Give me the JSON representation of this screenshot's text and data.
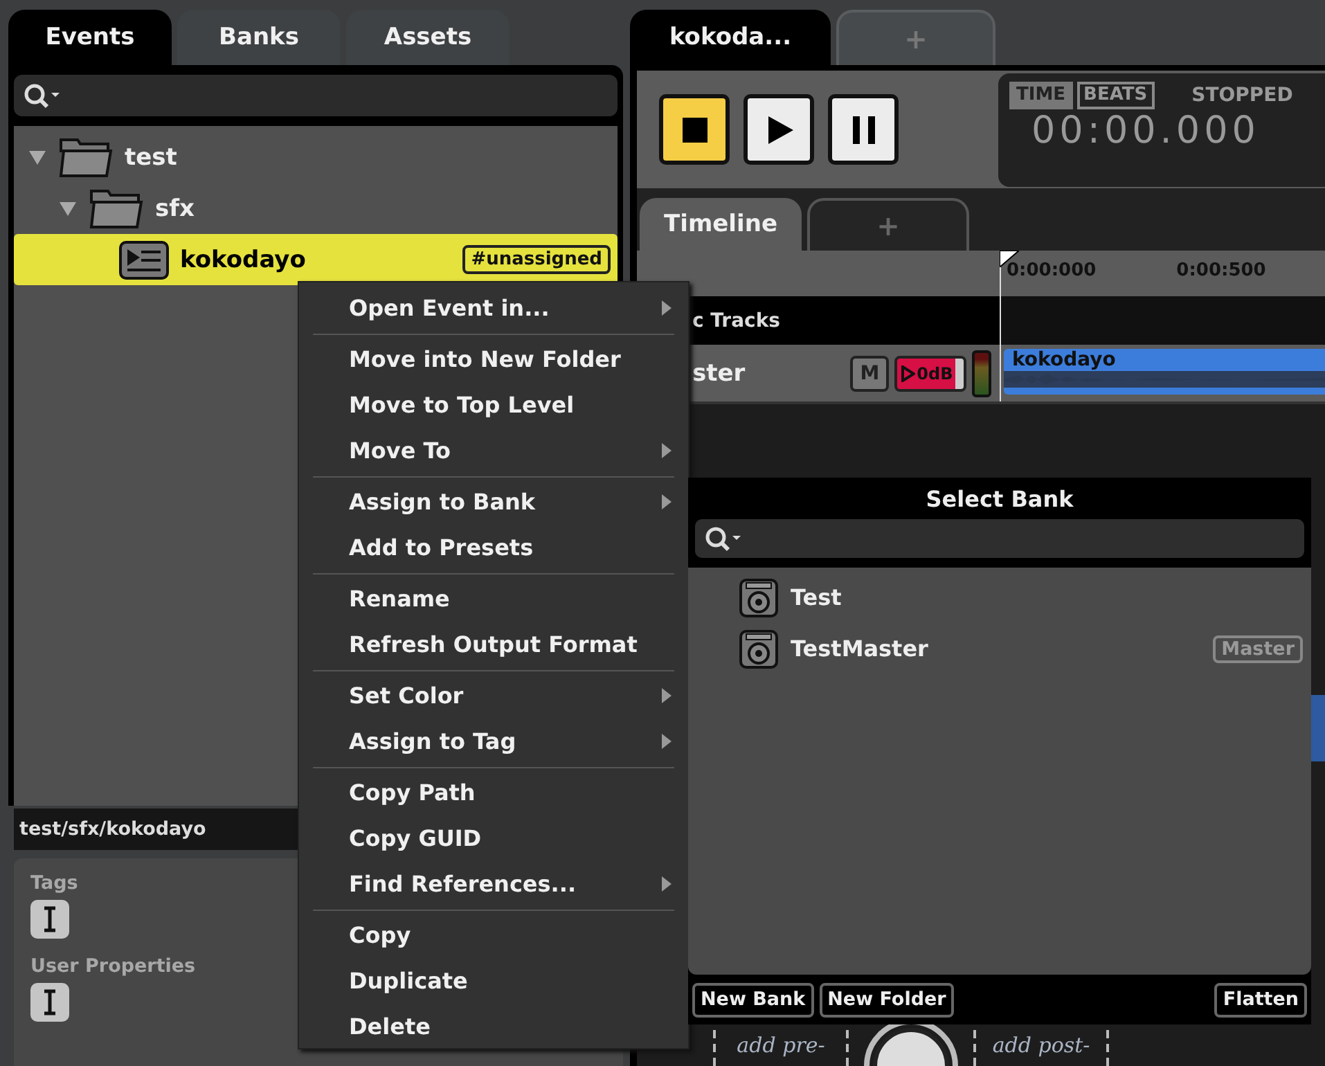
{
  "browser": {
    "tabs": [
      {
        "label": "Events",
        "selected": true
      },
      {
        "label": "Banks",
        "selected": false
      },
      {
        "label": "Assets",
        "selected": false
      }
    ],
    "tree": [
      {
        "name": "test",
        "kind": "folder",
        "expanded": true,
        "selected": false,
        "children": [
          {
            "name": "sfx",
            "kind": "folder",
            "expanded": true,
            "selected": false,
            "children": [
              {
                "name": "kokodayo",
                "kind": "event",
                "selected": true,
                "tag": "#unassigned"
              }
            ]
          }
        ]
      }
    ],
    "path": "test/sfx/kokodayo",
    "properties": [
      {
        "label": "Tags"
      },
      {
        "label": "User Properties"
      }
    ]
  },
  "editor": {
    "tabs": [
      {
        "label": "kokoda...",
        "selected": true
      },
      {
        "label": "+",
        "selected": false
      }
    ],
    "transport": [
      {
        "kind": "stop",
        "active": true
      },
      {
        "kind": "play",
        "active": false
      },
      {
        "kind": "pause",
        "active": false
      }
    ],
    "time_modes": [
      {
        "label": "TIME",
        "selected": true
      },
      {
        "label": "BEATS",
        "selected": false
      }
    ],
    "status": "STOPPED",
    "time": "00:00.000",
    "subtabs": [
      {
        "label": "Timeline",
        "selected": true
      },
      {
        "label": "+",
        "selected": false
      }
    ],
    "ruler": [
      "0:00:000",
      "0:00:500"
    ],
    "tracks": [
      {
        "name": "c Tracks",
        "kind": "group"
      },
      {
        "name": "ster",
        "kind": "master",
        "mute": "M",
        "volume": "0dB",
        "region": "kokodayo"
      }
    ],
    "deck": [
      "add pre-",
      "add post-"
    ]
  },
  "context_menu": [
    [
      {
        "label": "Open Event in...",
        "submenu": true
      }
    ],
    [
      {
        "label": "Move into New Folder",
        "submenu": false
      },
      {
        "label": "Move to Top Level",
        "submenu": false
      },
      {
        "label": "Move To",
        "submenu": true
      }
    ],
    [
      {
        "label": "Assign to Bank",
        "submenu": true
      },
      {
        "label": "Add to Presets",
        "submenu": false
      }
    ],
    [
      {
        "label": "Rename",
        "submenu": false
      },
      {
        "label": "Refresh Output Format",
        "submenu": false
      }
    ],
    [
      {
        "label": "Set Color",
        "submenu": true
      },
      {
        "label": "Assign to Tag",
        "submenu": true
      }
    ],
    [
      {
        "label": "Copy Path",
        "submenu": false
      },
      {
        "label": "Copy GUID",
        "submenu": false
      },
      {
        "label": "Find References...",
        "submenu": true
      }
    ],
    [
      {
        "label": "Copy",
        "submenu": false
      },
      {
        "label": "Duplicate",
        "submenu": false
      },
      {
        "label": "Delete",
        "submenu": false
      }
    ]
  ],
  "bank_dialog": {
    "title": "Select Bank",
    "banks": [
      {
        "name": "Test"
      },
      {
        "name": "TestMaster",
        "badge": "Master"
      }
    ],
    "buttons": [
      {
        "label": "New Bank"
      },
      {
        "label": "New Folder"
      },
      {
        "label": "Flatten"
      }
    ]
  }
}
